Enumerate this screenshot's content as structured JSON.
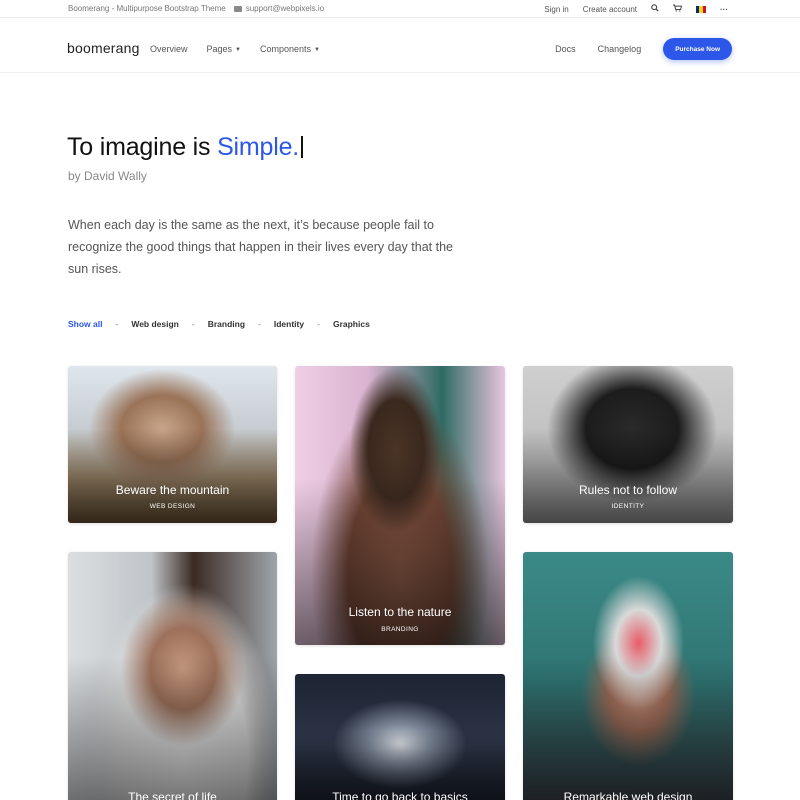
{
  "topbar": {
    "site_name": "Boomerang - Multipurpose Bootstrap Theme",
    "email": "support@webpixels.io",
    "sign_in": "Sign in",
    "create_account": "Create account",
    "more": "···"
  },
  "navbar": {
    "logo": "boomerang",
    "links": [
      {
        "label": "Overview"
      },
      {
        "label": "Pages",
        "dropdown": true
      },
      {
        "label": "Components",
        "dropdown": true
      }
    ],
    "docs": "Docs",
    "changelog": "Changelog",
    "cta": "Purchase Now"
  },
  "hero": {
    "title_prefix": "To imagine is",
    "title_accent": "Simple.",
    "byline": "by David Wally",
    "description": "When each day is the same as the next, it’s because people fail to recognize the good things that happen in their lives every day that the sun rises."
  },
  "filters": [
    {
      "label": "Show all",
      "active": true
    },
    {
      "label": "Web design"
    },
    {
      "label": "Branding"
    },
    {
      "label": "Identity"
    },
    {
      "label": "Graphics"
    }
  ],
  "portfolio": [
    {
      "title": "Beware the mountain",
      "category": "WEB DESIGN"
    },
    {
      "title": "Listen to the nature",
      "category": "BRANDING"
    },
    {
      "title": "Rules not to follow",
      "category": "IDENTITY"
    },
    {
      "title": "The secret of life"
    },
    {
      "title": "Time to go back to basics"
    },
    {
      "title": "Remarkable web design"
    }
  ],
  "colors": {
    "accent": "#2c57e8",
    "flag": [
      "#002b7f",
      "#fcd116",
      "#ce1126"
    ]
  }
}
